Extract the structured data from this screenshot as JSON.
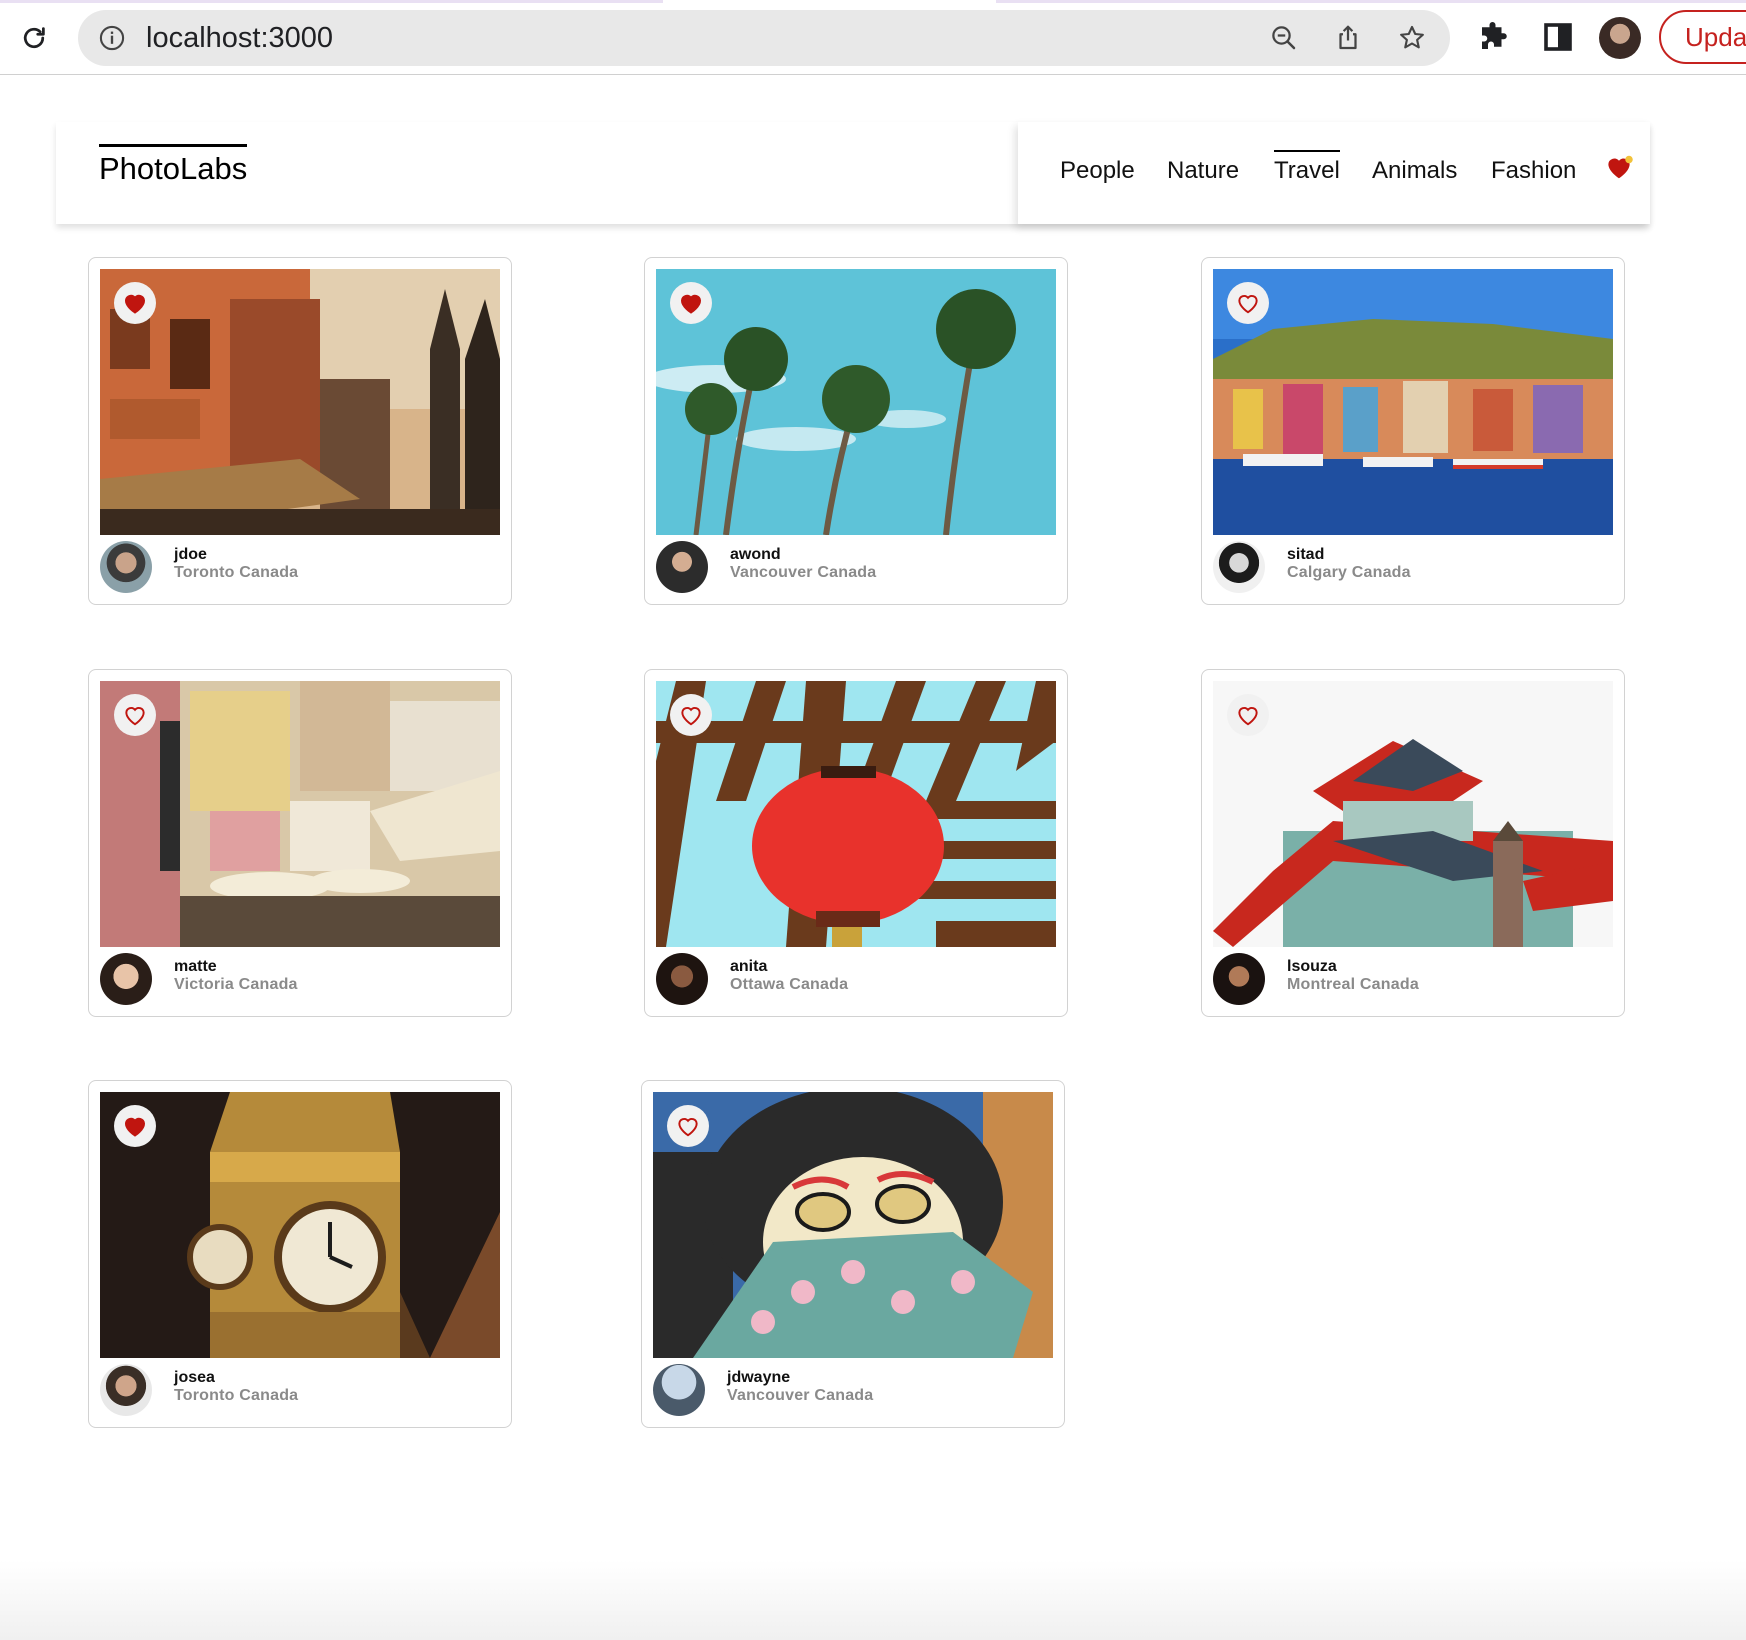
{
  "browser": {
    "url": "localhost:3000",
    "update_label": "Upda"
  },
  "nav": {
    "logo": "PhotoLabs",
    "topics": [
      "People",
      "Nature",
      "Travel",
      "Animals",
      "Fashion"
    ],
    "active_topic": "Travel",
    "has_favorites": true
  },
  "colors": {
    "heart": "#c0150f",
    "brand": "#000000",
    "update_accent": "#c5221f"
  },
  "photos": [
    {
      "username": "jdoe",
      "location": "Toronto Canada",
      "favorited": true
    },
    {
      "username": "awond",
      "location": "Vancouver Canada",
      "favorited": true
    },
    {
      "username": "sitad",
      "location": "Calgary Canada",
      "favorited": false
    },
    {
      "username": "matte",
      "location": "Victoria Canada",
      "favorited": false
    },
    {
      "username": "anita",
      "location": "Ottawa Canada",
      "favorited": false
    },
    {
      "username": "lsouza",
      "location": "Montreal Canada",
      "favorited": false
    },
    {
      "username": "josea",
      "location": "Toronto Canada",
      "favorited": true
    },
    {
      "username": "jdwayne",
      "location": "Vancouver Canada",
      "favorited": false
    }
  ]
}
